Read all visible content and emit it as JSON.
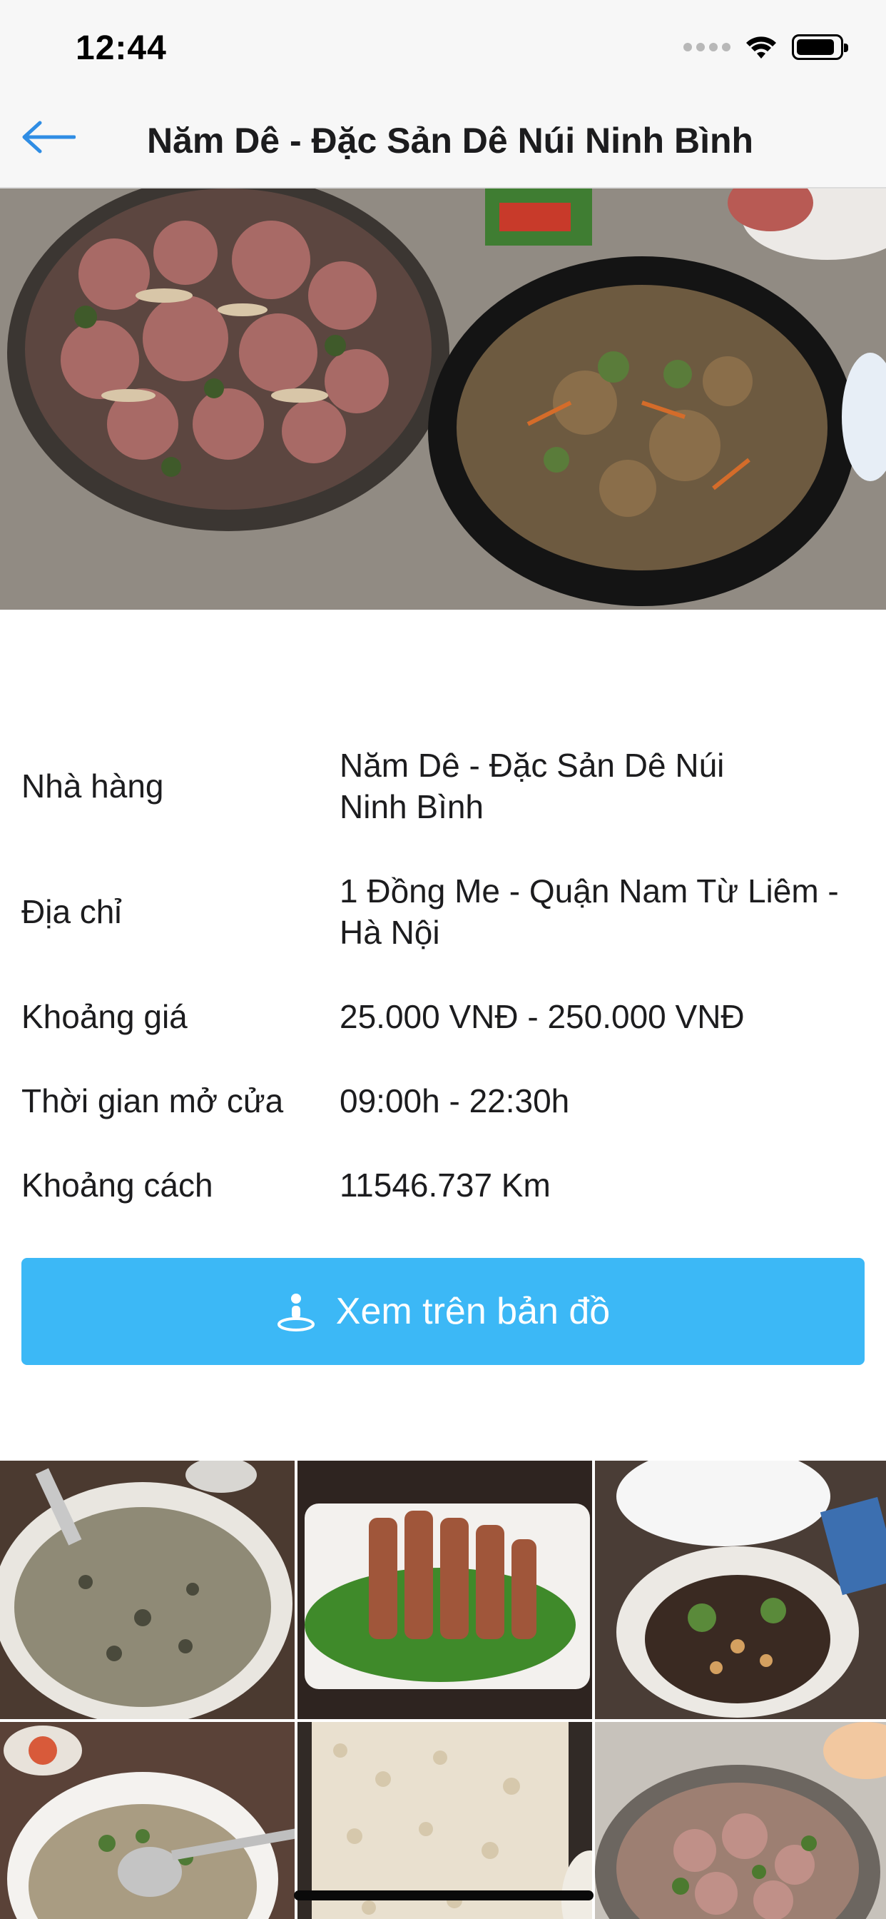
{
  "status_bar": {
    "time": "12:44"
  },
  "nav": {
    "title": "Năm Dê - Đặc Sản Dê Núi Ninh Bình"
  },
  "info": {
    "restaurant_label": "Nhà hàng",
    "restaurant_value": "Năm Dê - Đặc Sản Dê Núi Ninh Bình",
    "address_label": "Địa chỉ",
    "address_value": "1 Đồng Me - Quận Nam Từ Liêm - Hà Nội",
    "price_label": "Khoảng giá",
    "price_value": "25.000 VNĐ - 250.000 VNĐ",
    "hours_label": "Thời gian mở cửa",
    "hours_value": "09:00h - 22:30h",
    "distance_label": "Khoảng cách",
    "distance_value": "11546.737 Km"
  },
  "map_button": {
    "label": "Xem trên bản đồ",
    "icon": "map-pin-person-icon"
  },
  "colors": {
    "accent": "#3cb8f6",
    "back_arrow": "#2f8de4"
  },
  "gallery": {
    "thumbs": [
      "porridge",
      "sliced-meat-on-greens",
      "stir-fry-dish",
      "soup-bowl",
      "rice-crackers",
      "hotpot"
    ]
  }
}
